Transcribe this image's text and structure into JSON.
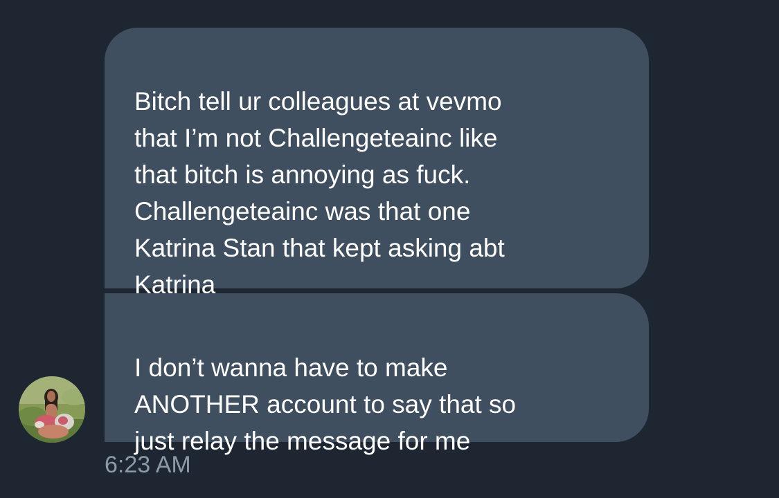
{
  "messages": [
    {
      "text": "Bitch tell ur colleagues at vevmo\nthat I’m not Challengeteainc like\nthat bitch is annoying as fuck.\nChallengeteainc was that one\nKatrina Stan that kept asking abt\nKatrina"
    },
    {
      "text": "I don’t wanna have to make\nANOTHER account to say that so\njust relay the message for me"
    }
  ],
  "timestamp": "6:23 AM",
  "colors": {
    "background": "#1e2631",
    "bubble": "#3f4f5f",
    "text": "#ffffff",
    "timestamp": "#8d9aa8"
  }
}
